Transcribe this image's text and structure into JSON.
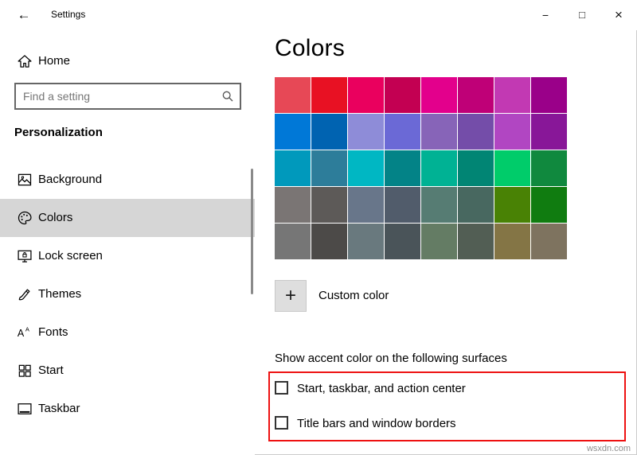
{
  "window": {
    "title": "Settings",
    "back_icon": "←",
    "controls": {
      "minimize": "−",
      "maximize": "□",
      "close": "×"
    }
  },
  "sidebar": {
    "home_label": "Home",
    "search": {
      "placeholder": "Find a setting",
      "value": ""
    },
    "section_heading": "Personalization",
    "items": [
      {
        "label": "Background",
        "icon": "background-icon",
        "selected": false
      },
      {
        "label": "Colors",
        "icon": "colors-palette-icon",
        "selected": true
      },
      {
        "label": "Lock screen",
        "icon": "lock-screen-icon",
        "selected": false
      },
      {
        "label": "Themes",
        "icon": "themes-icon",
        "selected": false
      },
      {
        "label": "Fonts",
        "icon": "fonts-icon",
        "selected": false
      },
      {
        "label": "Start",
        "icon": "start-icon",
        "selected": false
      },
      {
        "label": "Taskbar",
        "icon": "taskbar-icon",
        "selected": false
      }
    ]
  },
  "main": {
    "title": "Colors",
    "swatch_rows": [
      [
        "#e74856",
        "#e81123",
        "#ea005e",
        "#c30052",
        "#e3008c",
        "#bf0077",
        "#c239b3",
        "#9a0089"
      ],
      [
        "#0078d7",
        "#0063b1",
        "#8e8cd8",
        "#6b69d6",
        "#8764b8",
        "#744da9",
        "#b146c2",
        "#881798"
      ],
      [
        "#0099bc",
        "#2d7d9a",
        "#00b7c3",
        "#038387",
        "#00b294",
        "#018574",
        "#00cc6a",
        "#10893e"
      ],
      [
        "#7a7574",
        "#5d5a58",
        "#68768a",
        "#515c6b",
        "#567c73",
        "#486860",
        "#498205",
        "#107c10"
      ],
      [
        "#767676",
        "#4c4a48",
        "#69797e",
        "#4a5459",
        "#647c64",
        "#525e54",
        "#847545",
        "#7e735f"
      ]
    ],
    "custom_color": {
      "plus": "+",
      "label": "Custom color"
    },
    "accent_heading": "Show accent color on the following surfaces",
    "checkboxes": [
      {
        "label": "Start, taskbar, and action center",
        "checked": false
      },
      {
        "label": "Title bars and window borders",
        "checked": false
      }
    ],
    "annotation_border_color": "#ee1111"
  },
  "watermark": "wsxdn.com"
}
